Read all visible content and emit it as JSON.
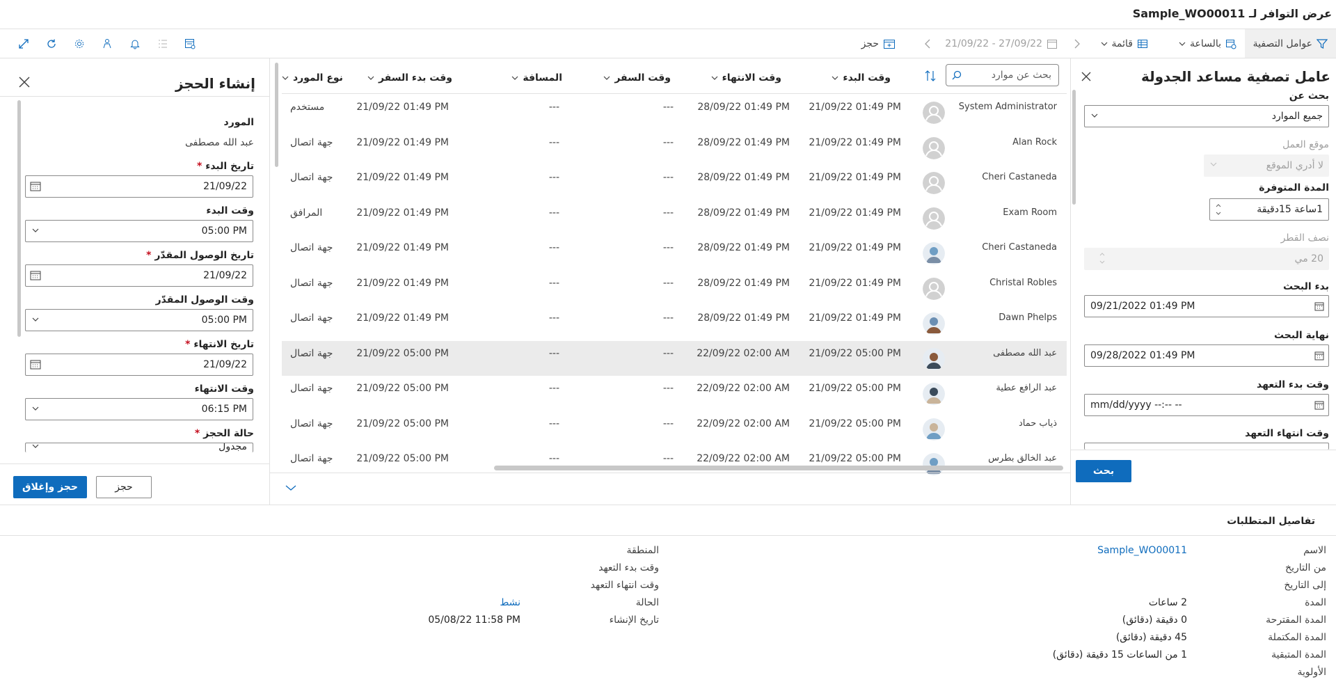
{
  "window": {
    "title": "عرض التوافر لـ Sample_WO00011"
  },
  "toolbar": {
    "filters": "عوامل التصفية",
    "hourly": "بالساعة",
    "list": "قائمة",
    "date_range": "21/09/22 - 27/09/22",
    "book": "حجز"
  },
  "filter_panel": {
    "title": "عامل تصفية مساعد الجدولة",
    "search_for_label": "بحث عن",
    "search_for_value": "جميع الموارد",
    "work_location_label": "موقع العمل",
    "work_location_value": "لا أدري الموقع",
    "available_duration_label": "المدة المتوفرة",
    "available_duration_value": "1ساعة 15دقيقة",
    "radius_label": "نصف القطر",
    "radius_value": "20 مي",
    "search_start_label": "بدء البحث",
    "search_start_value": "09/21/2022  01:49  PM",
    "search_end_label": "نهاية البحث",
    "search_end_value": "09/28/2022  01:49  PM",
    "promised_start_label": "وقت بدء التعهد",
    "promised_start_value": "mm/dd/yyyy  --:--  --",
    "promised_end_label": "وقت انتهاء التعهد",
    "search_button": "بحث"
  },
  "grid": {
    "search_placeholder": "بحث عن موارد",
    "headers": {
      "start_time": "وقت البدء",
      "end_time": "وقت الانتهاء",
      "travel_time": "وقت السفر",
      "distance": "المسافة",
      "travel_start": "وقت بدء السفر",
      "resource_type": "نوع المورد"
    },
    "rows": [
      {
        "name": "System Administrator",
        "start": "21/09/22 01:49 PM",
        "end": "28/09/22 01:49 PM",
        "travel": "---",
        "distance": "---",
        "travel_start": "21/09/22 01:49 PM",
        "type": "مستخدم",
        "avatar": "default"
      },
      {
        "name": "Alan Rock",
        "start": "21/09/22 01:49 PM",
        "end": "28/09/22 01:49 PM",
        "travel": "---",
        "distance": "---",
        "travel_start": "21/09/22 01:49 PM",
        "type": "جهة اتصال",
        "avatar": "default"
      },
      {
        "name": "Cheri Castaneda",
        "start": "21/09/22 01:49 PM",
        "end": "28/09/22 01:49 PM",
        "travel": "---",
        "distance": "---",
        "travel_start": "21/09/22 01:49 PM",
        "type": "جهة اتصال",
        "avatar": "default"
      },
      {
        "name": "Exam Room",
        "start": "21/09/22 01:49 PM",
        "end": "28/09/22 01:49 PM",
        "travel": "---",
        "distance": "---",
        "travel_start": "21/09/22 01:49 PM",
        "type": "المرافق",
        "avatar": "default"
      },
      {
        "name": "Cheri Castaneda",
        "start": "21/09/22 01:49 PM",
        "end": "28/09/22 01:49 PM",
        "travel": "---",
        "distance": "---",
        "travel_start": "21/09/22 01:49 PM",
        "type": "جهة اتصال",
        "avatar": "photo"
      },
      {
        "name": "Christal Robles",
        "start": "21/09/22 01:49 PM",
        "end": "28/09/22 01:49 PM",
        "travel": "---",
        "distance": "---",
        "travel_start": "21/09/22 01:49 PM",
        "type": "جهة اتصال",
        "avatar": "default"
      },
      {
        "name": "Dawn Phelps",
        "start": "21/09/22 01:49 PM",
        "end": "28/09/22 01:49 PM",
        "travel": "---",
        "distance": "---",
        "travel_start": "21/09/22 01:49 PM",
        "type": "جهة اتصال",
        "avatar": "photo"
      },
      {
        "name": "عبد الله مصطفى",
        "start": "21/09/22 05:00 PM",
        "end": "22/09/22 02:00 AM",
        "travel": "---",
        "distance": "---",
        "travel_start": "21/09/22 05:00 PM",
        "type": "جهة اتصال",
        "avatar": "photo"
      },
      {
        "name": "عبد الرافع عطية",
        "start": "21/09/22 05:00 PM",
        "end": "22/09/22 02:00 AM",
        "travel": "---",
        "distance": "---",
        "travel_start": "21/09/22 05:00 PM",
        "type": "جهة اتصال",
        "avatar": "photo"
      },
      {
        "name": "ذياب حماد",
        "start": "21/09/22 05:00 PM",
        "end": "22/09/22 02:00 AM",
        "travel": "---",
        "distance": "---",
        "travel_start": "21/09/22 05:00 PM",
        "type": "جهة اتصال",
        "avatar": "photo"
      },
      {
        "name": "عبد الخالق بطرس",
        "start": "21/09/22 05:00 PM",
        "end": "22/09/22 02:00 AM",
        "travel": "---",
        "distance": "---",
        "travel_start": "21/09/22 05:00 PM",
        "type": "جهة اتصال",
        "avatar": "photo"
      }
    ]
  },
  "booking_panel": {
    "title": "إنشاء الحجز",
    "resource_label": "المورد",
    "resource_value": "عبد الله مصطفى",
    "start_date_label": "تاريخ البدء",
    "start_date_value": "21/09/22",
    "start_time_label": "وقت البدء",
    "start_time_value": "05:00 PM",
    "eta_date_label": "تاريخ الوصول المقدّر",
    "eta_date_value": "21/09/22",
    "eta_time_label": "وقت الوصول المقدّر",
    "eta_time_value": "05:00 PM",
    "end_date_label": "تاريخ الانتهاء",
    "end_date_value": "21/09/22",
    "end_time_label": "وقت الانتهاء",
    "end_time_value": "06:15 PM",
    "status_label": "حالة الحجز",
    "status_value": "مجدول",
    "required_mark": "*",
    "book_button": "حجز",
    "book_close_button": "حجز وإغلاق"
  },
  "details": {
    "title": "تفاصيل المتطلبات",
    "name_label": "الاسم",
    "name_value": "Sample_WO00011",
    "from_date_label": "من التاريخ",
    "to_date_label": "إلى التاريخ",
    "duration_label": "المدة",
    "duration_value": "2 ساعات",
    "proposed_label": "المدة المقترحة",
    "proposed_value": "0 دقيقة (دقائق)",
    "completed_label": "المدة المكتملة",
    "completed_value": "45 دقيقة (دقائق)",
    "remaining_label": "المدة المتبقية",
    "remaining_value": "1  من الساعات 15 دقيقة (دقائق)",
    "priority_label": "الأولوية",
    "territory_label": "المنطقة",
    "promised_start_label": "وقت بدء التعهد",
    "promised_end_label": "وقت انتهاء التعهد",
    "status_label": "الحالة",
    "status_value": "نشط",
    "created_label": "تاريخ الإنشاء",
    "created_value": "05/08/22 11:58 PM"
  }
}
